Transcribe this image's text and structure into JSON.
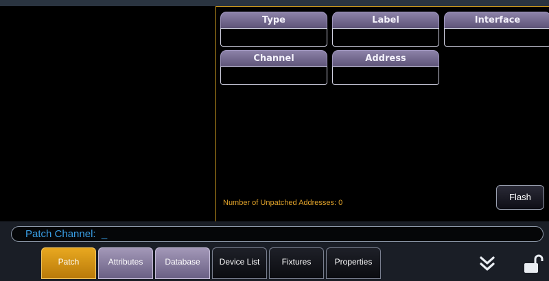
{
  "patch_fields": {
    "type": {
      "label": "Type",
      "value": ""
    },
    "label": {
      "label": "Label",
      "value": ""
    },
    "interface": {
      "label": "Interface",
      "value": ""
    },
    "channel": {
      "label": "Channel",
      "value": ""
    },
    "address": {
      "label": "Address",
      "value": ""
    }
  },
  "status": {
    "unpatched": "Number of Unpatched Addresses: 0"
  },
  "buttons": {
    "flash": "Flash"
  },
  "command_line": {
    "text": "Patch Channel:  _"
  },
  "tabs": [
    {
      "label": "Patch",
      "active": true
    },
    {
      "label": "Attributes",
      "active": false
    },
    {
      "label": "Database",
      "active": false
    },
    {
      "label": "Device List",
      "active": false
    },
    {
      "label": "Fixtures",
      "active": false
    },
    {
      "label": "Properties",
      "active": false
    }
  ],
  "icons": {
    "more": "double-chevron-down-icon",
    "lock": "unlock-icon"
  },
  "colors": {
    "accent": "#e8a820",
    "command_text": "#3aa0e8",
    "status_text": "#e0a22a"
  }
}
